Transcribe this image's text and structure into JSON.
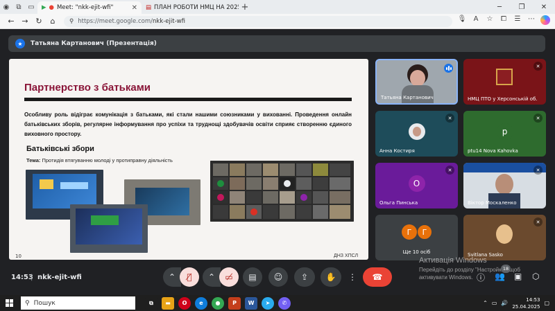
{
  "browser": {
    "tabs": [
      {
        "title": "Meet: \"nkk-ejit-wfi\"",
        "active": true
      },
      {
        "title": "ПЛАН РОБОТИ НМЦ НА 2025 р",
        "active": false
      }
    ],
    "new_tab": "+",
    "url_host": "https://meet.google.com/",
    "url_path": "nkk-ejit-wfi"
  },
  "meet": {
    "presenter_label": "Татьяна Картанович (Презентація)",
    "slide": {
      "title": "Партнерство з батьками",
      "body": "Особливу роль відіграє комунікація з батьками, які стали нашими союзниками у вихованні. Проведення онлайн батьківських зборів, регулярне інформування про успіхи та труднощі здобувачів освіти сприяє створенню єдиного виховного простору.",
      "subtitle": "Батьківські збори",
      "topic_label": "Тема:",
      "topic_text": "Протидія втягуванню молоді у протиправну діяльність",
      "page": "10",
      "brand": "ДНЗ ХПСЛ"
    },
    "tiles": [
      {
        "name": "Татьяна Картанович",
        "color": "#9fa7ae",
        "speaking": true
      },
      {
        "name": "НМЦ ПТО у Херсонській об...",
        "color": "#7a1418",
        "muted": true
      },
      {
        "name": "Анна Костиря",
        "color": "#1e4c5a",
        "muted": true
      },
      {
        "name": "ptu14 Nova Kahovka",
        "color": "#2e6b2e",
        "muted": true,
        "initial": "p",
        "avatar_color": "#2e6b2e"
      },
      {
        "name": "Ольга Пинська",
        "color": "#6a1b9a",
        "muted": true,
        "initial": "О",
        "avatar_color": "#8e24aa"
      },
      {
        "name": "Віктор Москаленко",
        "color": "#d7dde3",
        "muted": true
      },
      {
        "name": "Ще 10 осіб",
        "color": "#3c4043",
        "initials": [
          "Г",
          "Г"
        ]
      },
      {
        "name": "Svitlana Sasko",
        "color": "#6b4a2e",
        "muted": true
      }
    ],
    "bottom": {
      "time": "14:53",
      "separator": "|",
      "code": "nkk-ejit-wfi",
      "participants_count": "18"
    },
    "activation": {
      "title": "Активація Windows",
      "line": "Перейдіть до розділу \"Настройки\", щоб активувати Windows."
    }
  },
  "taskbar": {
    "search_placeholder": "Пошук",
    "time": "14:53",
    "date": "25.04.2025",
    "apps": [
      {
        "icon": "task-view-icon",
        "label": "⧉",
        "color": "#1f1f1f"
      },
      {
        "icon": "file-explorer-icon",
        "label": "▬",
        "color": "#e8a317"
      },
      {
        "icon": "opera-icon",
        "label": "O",
        "color": "#d0021b"
      },
      {
        "icon": "edge-icon",
        "label": "e",
        "color": "#0f7ddb"
      },
      {
        "icon": "chrome-icon",
        "label": "●",
        "color": "#34a853"
      },
      {
        "icon": "powerpoint-icon",
        "label": "P",
        "color": "#c43e1c"
      },
      {
        "icon": "word-icon",
        "label": "W",
        "color": "#2b579a"
      },
      {
        "icon": "telegram-icon",
        "label": "➤",
        "color": "#2aabee"
      },
      {
        "icon": "viber-icon",
        "label": "✆",
        "color": "#7360f2"
      }
    ]
  }
}
